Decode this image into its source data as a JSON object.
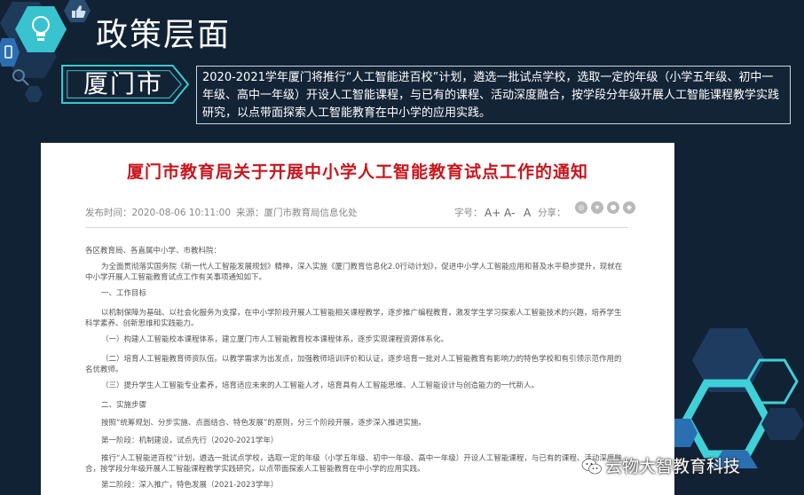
{
  "slide": {
    "title": "政策层面",
    "city": "厦门市",
    "intro": "2020-2021学年厦门将推行“人工智能进百校”计划，遴选一批试点学校，选取一定的年级（小学五年级、初中一年级、高中一年级）开设人工智能课程，与已有的课程、活动深度融合，按学段分年级开展人工智能课程教学实践研究，以点带面探索人工智能教育在中小学的应用实践。"
  },
  "article": {
    "title": "厦门市教育局关于开展中小学人工智能教育试点工作的通知",
    "publish_time": "发布时间：2020-08-06 10:11:00",
    "source": "来源：厦门市教育局信息化处",
    "font_size_label": "字号：",
    "font_large": "A+",
    "font_small": "A-",
    "font_normal": "A",
    "share_label": "分享：",
    "paragraphs": [
      "各区教育局、各直属中小学、市教科院：",
      "为全面贯彻落实国务院《新一代人工智能发展规划》精神，深入实施《厦门教育信息化2.0行动计划》，促进中小学人工智能应用和普及水平稳步提升，现就在中小学开展人工智能教育试点工作有关事项通知如下。",
      "一、工作目标",
      "以机制保障为基础、以社会化服务为支撑，在中小学阶段开展人工智能相关课程教学，逐步推广编程教育，激发学生学习探索人工智能技术的兴趣，培养学生科学素养、创新思维和实践能力。",
      "（一）构建人工智能校本课程体系，建立厦门市人工智能教育校本课程体系，逐步实现课程资源体系化。",
      "（二）培育人工智能教育师资队伍。以教学需求为出发点，加强教师培训评价和认证，逐步培育一批对人工智能教育有影响力的特色学校和有引领示范作用的名优教师。",
      "（三）提升学生人工智能专业素养，培育适应未来的人工智能人才，培育具有人工智能思维、人工智能设计与创造能力的一代新人。",
      "二、实施步骤",
      "按照“统筹规划、分步实施、点面结合、特色发展”的原则，分三个阶段开展，逐步深入推进实施。",
      "第一阶段：机制建设，试点先行（2020-2021学年）",
      "推行“人工智能进百校”计划，遴选一批试点学校，选取一定的年级（小学五年级、初中一年级、高中一年级）开设人工智能课程，与已有的课程、活动深度融合，按学段分年级开展人工智能课程教学实践研究，以点带面探索人工智能教育在中小学的应用实践。",
      "第二阶段：深入推广，特色发展（2021-2023学年）"
    ]
  },
  "watermark": {
    "text": "云物大智教育科技"
  },
  "colors": {
    "background": "#122235",
    "accent_cyan": "#3fd0d8",
    "accent_blue": "#2b6fb3",
    "article_title_red": "#c8161d"
  },
  "icons": [
    "lightbulb-icon",
    "thumbs-up-icon",
    "phone-icon",
    "search-icon",
    "wechat-icon"
  ]
}
